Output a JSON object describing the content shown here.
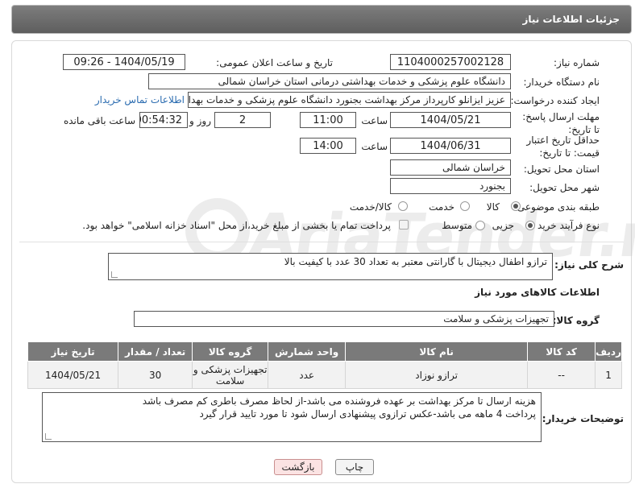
{
  "header": {
    "title": "جزئیات اطلاعات نیاز"
  },
  "form": {
    "need_number_label": "شماره نیاز:",
    "need_number": "1104000257002128",
    "announce_label": "تاریخ و ساعت اعلان عمومی:",
    "announce_value": "1404/05/19 - 09:26",
    "buyer_org_label": "نام دستگاه خریدار:",
    "buyer_org": "دانشگاه علوم پزشکی و خدمات بهداشتی درمانی استان خراسان شمالی",
    "creator_label": "ایجاد کننده درخواست:",
    "creator": "عزیز ایزانلو کارپرداز مرکز بهداشت بجنورد دانشگاه علوم پزشکی و خدمات بهداشت",
    "contact_link": "اطلاعات تماس خریدار",
    "reply_deadline_label": "مهلت ارسال پاسخ: تا تاریخ:",
    "reply_date": "1404/05/21",
    "time_label": "ساعت",
    "reply_time": "11:00",
    "days_value": "2",
    "days_label": "روز و",
    "remaining_time": "00:54:32",
    "remaining_label": "ساعت باقی مانده",
    "price_validity_label": "حداقل تاریخ اعتبار قیمت: تا تاریخ:",
    "price_date": "1404/06/31",
    "price_time": "14:00",
    "province_label": "استان محل تحویل:",
    "province": "خراسان شمالی",
    "city_label": "شهر محل تحویل:",
    "city": "بجنورد",
    "category_label": "طبقه بندی موضوعی:",
    "category_options": [
      "کالا",
      "خدمت",
      "کالا/خدمت"
    ],
    "process_label": "نوع فرآیند خرید :",
    "process_options": [
      "جزیی",
      "متوسط"
    ],
    "payment_note": "پرداخت تمام یا بخشی از مبلغ خرید،از محل \"اسناد خزانه اسلامی\" خواهد بود.",
    "description_label": "شرح کلی نیاز:",
    "description": "ترازو اطفال دیجیتال با گارانتی معتبر به تعداد 30 عدد  با کیفیت بالا",
    "goods_info_title": "اطلاعات کالاهای مورد نیاز",
    "goods_group_label": "گروه کالا:",
    "goods_group": "تجهیزات پزشکی و سلامت"
  },
  "table": {
    "headers": [
      "ردیف",
      "کد کالا",
      "نام کالا",
      "واحد شمارش",
      "گروه کالا",
      "تعداد / مقدار",
      "تاریخ نیاز"
    ],
    "rows": [
      [
        "1",
        "--",
        "ترازو نوزاد",
        "عدد",
        "تجهیزات پزشکی و سلامت",
        "30",
        "1404/05/21"
      ]
    ]
  },
  "buyer_notes": {
    "label": "توضیحات خریدار:",
    "line1": "هزینه ارسال تا مرکز بهداشت بر عهده فروشنده می باشد-از لحاظ مصرف باطری کم مصرف باشد",
    "line2": "پرداخت 4 ماهه می باشد-عکس ترازوی پیشنهادی ارسال شود تا مورد تایید قرار گیرد"
  },
  "buttons": {
    "print": "چاپ",
    "back": "بازگشت"
  }
}
